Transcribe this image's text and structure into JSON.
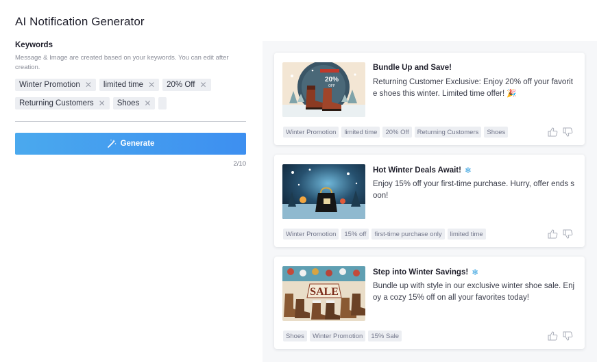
{
  "page": {
    "title": "AI Notification Generator"
  },
  "keywords": {
    "label": "Keywords",
    "help": "Message & Image are created based on your keywords. You can edit after creation.",
    "chips": [
      "Winter Promotion",
      "limited time",
      "20% Off",
      "Returning Customers",
      "Shoes"
    ]
  },
  "generate": {
    "label": "Generate",
    "counter": "2/10"
  },
  "cards": [
    {
      "title": "Bundle Up and Save!",
      "title_icon": "",
      "body": "Returning Customer Exclusive: Enjoy 20% off your favorite shoes this winter. Limited time offer! 🎉",
      "tags": [
        "Winter Promotion",
        "limited time",
        "20% Off",
        "Returning Customers",
        "Shoes"
      ],
      "image": {
        "subject": "boots-20-off",
        "text_main": "20%",
        "text_sub": "OFF"
      }
    },
    {
      "title": "Hot Winter Deals Await!",
      "title_icon": "❄",
      "body": "Enjoy 15% off your first-time purchase. Hurry, offer ends soon!",
      "tags": [
        "Winter Promotion",
        "15% off",
        "first-time purchase only",
        "limited time"
      ],
      "image": {
        "subject": "winter-shopping-bag"
      }
    },
    {
      "title": "Step into Winter Savings!",
      "title_icon": "❄",
      "body": "Bundle up with style in our exclusive winter shoe sale. Enjoy a cozy 15% off on all your favorites today!",
      "tags": [
        "Shoes",
        "Winter Promotion",
        "15% Sale"
      ],
      "image": {
        "subject": "sale-boots",
        "text_main": "SALE"
      }
    }
  ],
  "colors": {
    "accent_start": "#4aa9ee",
    "accent_end": "#3d8ff0",
    "panel_bg": "#f6f7f9",
    "chip_bg": "#eceef2"
  }
}
